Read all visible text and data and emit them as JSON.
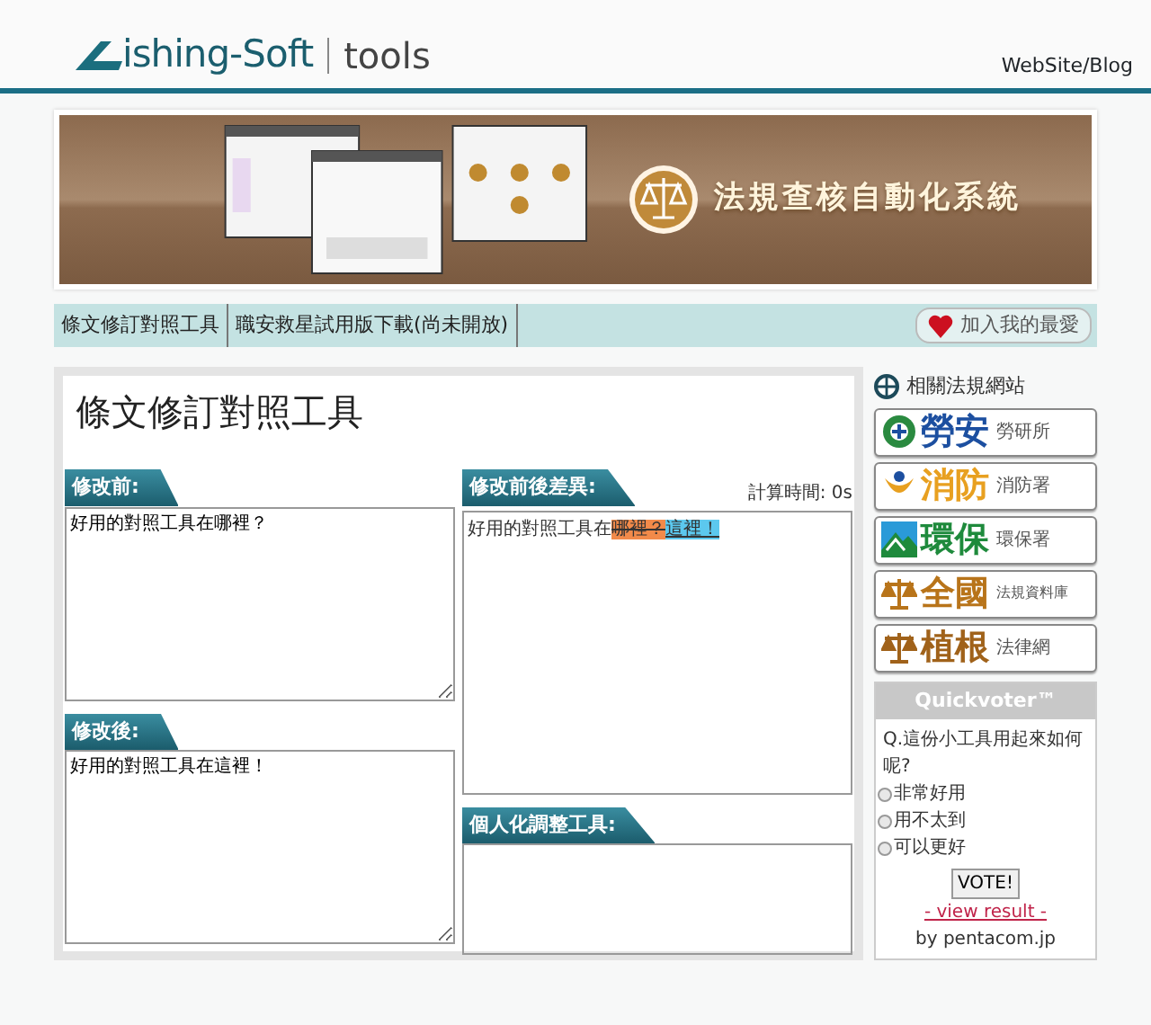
{
  "header": {
    "logo_text": "ishing-Soft",
    "logo_suffix": "tools",
    "link": "WebSite/Blog"
  },
  "banner": {
    "title": "法規查核自動化系統"
  },
  "nav": {
    "items": [
      {
        "label": "條文修訂對照工具"
      },
      {
        "label": "職安救星試用版下載(尚未開放)"
      }
    ],
    "favorite": "加入我的最愛"
  },
  "tool": {
    "title": "條文修訂對照工具",
    "before": {
      "label": "修改前:",
      "value": "好用的對照工具在哪裡？"
    },
    "after": {
      "label": "修改後:",
      "value": "好用的對照工具在這裡！"
    },
    "diff": {
      "label": "修改前後差異:",
      "timing": "計算時間: 0s",
      "segments": [
        {
          "kind": "same",
          "text": "好用的對照工具在"
        },
        {
          "kind": "deleted",
          "text": "哪裡？"
        },
        {
          "kind": "inserted",
          "text": "這裡！"
        }
      ]
    },
    "custom": {
      "label": "個人化調整工具:"
    }
  },
  "sidebar": {
    "title": "相關法規網站",
    "sites": [
      {
        "kind": "shield",
        "logo_text": "勞安",
        "label": "勞研所",
        "color": "#1c4fa0"
      },
      {
        "kind": "flame",
        "logo_text": "消防",
        "label": "消防署",
        "color": "#e8a020"
      },
      {
        "kind": "mountain",
        "logo_text": "環保",
        "label": "環保署",
        "color": "#1e8a3c"
      },
      {
        "kind": "scales",
        "logo_text": "全國",
        "label": "法規資料庫",
        "color": "#b8741a"
      },
      {
        "kind": "scales",
        "logo_text": "植根",
        "label": "法律網",
        "color": "#a0621a"
      }
    ],
    "poll": {
      "title": "Quickvoter™",
      "question": "Q.這份小工具用起來如何呢?",
      "options": [
        {
          "label": "非常好用",
          "selected": false
        },
        {
          "label": "用不太到",
          "selected": false
        },
        {
          "label": "可以更好",
          "selected": false
        }
      ],
      "button": "VOTE!",
      "result_link": "- view result -",
      "credit": "by pentacom.jp"
    }
  }
}
